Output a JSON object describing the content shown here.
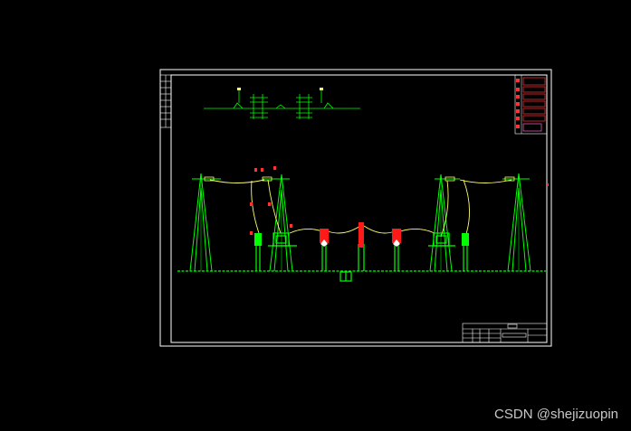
{
  "watermark": {
    "text": "CSDN @shejizuopin"
  },
  "colors": {
    "background": "#000000",
    "frame": "#ffffff",
    "structure": "#00ff00",
    "conductor": "#ffff66",
    "equipment": "#ff1a1a",
    "legend_accent": "#ff66cc",
    "annotation": "#ff3333"
  },
  "icons": {
    "tower": "lattice-tower-icon",
    "insulator": "insulator-icon",
    "breaker": "breaker-icon",
    "foundation": "foundation-icon"
  }
}
